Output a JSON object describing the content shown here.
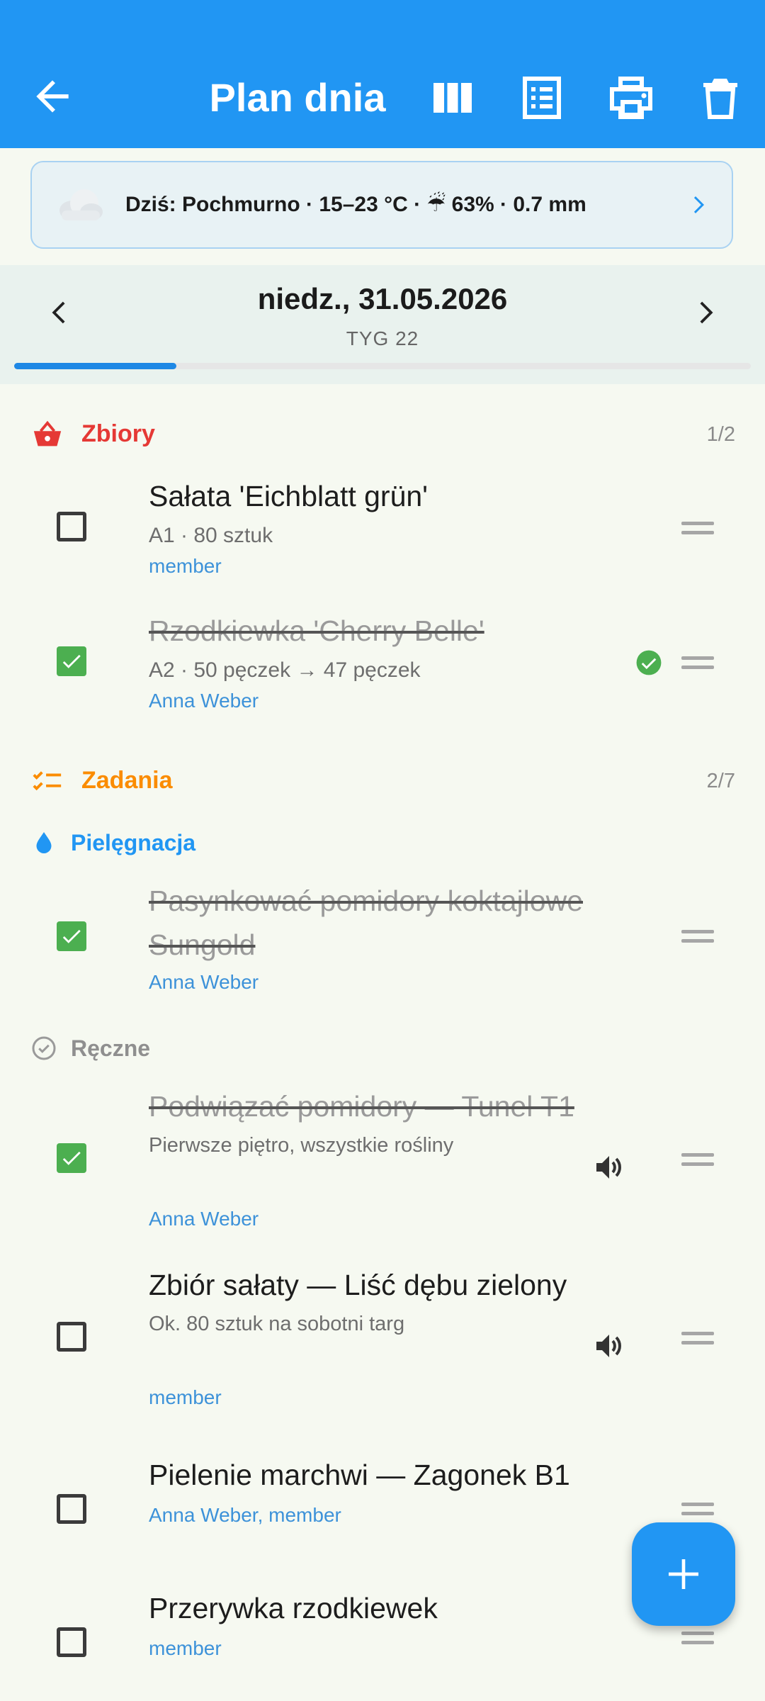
{
  "app_bar": {
    "title": "Plan dnia",
    "actions": [
      "columns-view-icon",
      "list-view-icon",
      "print-icon",
      "delete-icon"
    ]
  },
  "weather": {
    "text": "Dziś: Pochmurno · 15–23 °C · ☔ 63% · 0.7 mm"
  },
  "date_nav": {
    "date": "niedz., 31.05.2026",
    "week": "TYG 22",
    "progress": 0.22
  },
  "harvests": {
    "label": "Zbiory",
    "count": "1/2",
    "color": "#e53935",
    "items": [
      {
        "name": "Sałata 'Eichblatt grün'",
        "details": "A1 · 80 sztuk",
        "assignee": "member",
        "done": false
      },
      {
        "name": "Rzodkiewka 'Cherry Belle'",
        "details": "A2 · 50 pęczek → 47 pęczek",
        "assignee": "Anna Weber",
        "done": true
      }
    ]
  },
  "tasks": {
    "label": "Zadania",
    "count": "2/7",
    "color": "#fb8c00",
    "care": {
      "label": "Pielęgnacja",
      "items": [
        {
          "name_line1": "Pasynkować pomidory koktajlowe",
          "name_line2": "Sungold",
          "assignee": "Anna Weber",
          "done": true
        }
      ]
    },
    "manual": {
      "label": "Ręczne",
      "items": [
        {
          "name": "Podwiązać pomidory — Tunel T1",
          "note": "Pierwsze piętro, wszystkie rośliny",
          "assignee": "Anna Weber",
          "done": true
        },
        {
          "name": "Zbiór sałaty — Liść dębu zielony",
          "note": "Ok. 80 sztuk na sobotni targ",
          "assignee": "member",
          "done": false
        },
        {
          "name": "Pielenie marchwi — Zagonek B1",
          "assignee": "Anna Weber, member",
          "done": false
        },
        {
          "name": "Przerywka rzodkiewek",
          "assignee": "member",
          "done": false
        }
      ]
    }
  },
  "colors": {
    "primary": "#2196f3",
    "success": "#4caf50",
    "link": "#3d92d9"
  }
}
